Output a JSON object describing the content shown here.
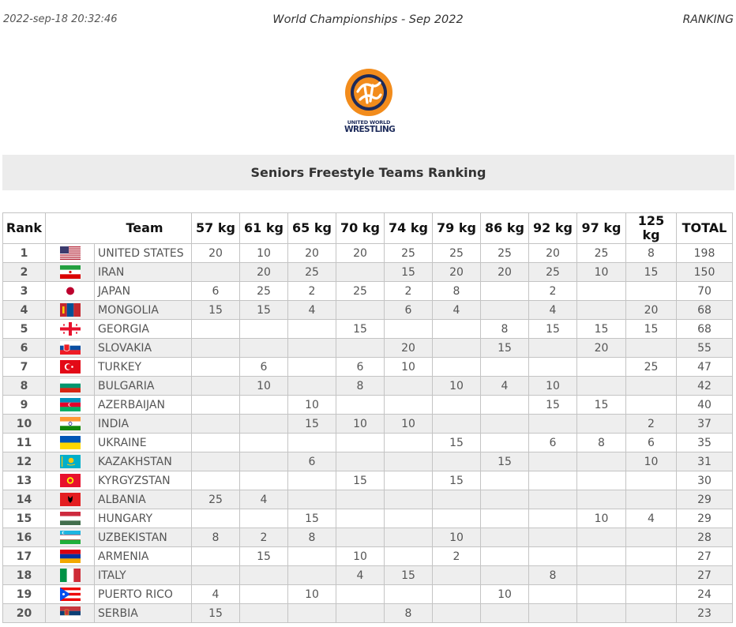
{
  "header": {
    "timestamp": "2022-sep-18 20:32:46",
    "event": "World Championships - Sep 2022",
    "section": "RANKING"
  },
  "logo": {
    "line1": "UNITED WORLD",
    "line2": "WRESTLING"
  },
  "banner": {
    "title": "Seniors Freestyle Teams Ranking"
  },
  "table": {
    "headers": {
      "rank": "Rank",
      "team": "Team",
      "weights": [
        "57 kg",
        "61 kg",
        "65 kg",
        "70 kg",
        "74 kg",
        "79 kg",
        "86 kg",
        "92 kg",
        "97 kg",
        "125 kg"
      ],
      "total": "TOTAL"
    },
    "rows": [
      {
        "rank": "1",
        "flag": "usa-flag-icon",
        "team": "UNITED STATES",
        "scores": [
          "20",
          "10",
          "20",
          "20",
          "25",
          "25",
          "25",
          "20",
          "25",
          "8"
        ],
        "total": "198"
      },
      {
        "rank": "2",
        "flag": "iran-flag-icon",
        "team": "IRAN",
        "scores": [
          "",
          "20",
          "25",
          "",
          "15",
          "20",
          "20",
          "25",
          "10",
          "15"
        ],
        "total": "150"
      },
      {
        "rank": "3",
        "flag": "japan-flag-icon",
        "team": "JAPAN",
        "scores": [
          "6",
          "25",
          "2",
          "25",
          "2",
          "8",
          "",
          "2",
          "",
          ""
        ],
        "total": "70"
      },
      {
        "rank": "4",
        "flag": "mongolia-flag-icon",
        "team": "MONGOLIA",
        "scores": [
          "15",
          "15",
          "4",
          "",
          "6",
          "4",
          "",
          "4",
          "",
          "20"
        ],
        "total": "68"
      },
      {
        "rank": "5",
        "flag": "georgia-flag-icon",
        "team": "GEORGIA",
        "scores": [
          "",
          "",
          "",
          "15",
          "",
          "",
          "8",
          "15",
          "15",
          "15"
        ],
        "total": "68"
      },
      {
        "rank": "6",
        "flag": "slovakia-flag-icon",
        "team": "SLOVAKIA",
        "scores": [
          "",
          "",
          "",
          "",
          "20",
          "",
          "15",
          "",
          "20",
          ""
        ],
        "total": "55"
      },
      {
        "rank": "7",
        "flag": "turkey-flag-icon",
        "team": "TURKEY",
        "scores": [
          "",
          "6",
          "",
          "6",
          "10",
          "",
          "",
          "",
          "",
          "25"
        ],
        "total": "47"
      },
      {
        "rank": "8",
        "flag": "bulgaria-flag-icon",
        "team": "BULGARIA",
        "scores": [
          "",
          "10",
          "",
          "8",
          "",
          "10",
          "4",
          "10",
          "",
          ""
        ],
        "total": "42"
      },
      {
        "rank": "9",
        "flag": "azerbaijan-flag-icon",
        "team": "AZERBAIJAN",
        "scores": [
          "",
          "",
          "10",
          "",
          "",
          "",
          "",
          "15",
          "15",
          ""
        ],
        "total": "40"
      },
      {
        "rank": "10",
        "flag": "india-flag-icon",
        "team": "INDIA",
        "scores": [
          "",
          "",
          "15",
          "10",
          "10",
          "",
          "",
          "",
          "",
          "2"
        ],
        "total": "37"
      },
      {
        "rank": "11",
        "flag": "ukraine-flag-icon",
        "team": "UKRAINE",
        "scores": [
          "",
          "",
          "",
          "",
          "",
          "15",
          "",
          "6",
          "8",
          "6"
        ],
        "total": "35"
      },
      {
        "rank": "12",
        "flag": "kazakhstan-flag-icon",
        "team": "KAZAKHSTAN",
        "scores": [
          "",
          "",
          "6",
          "",
          "",
          "",
          "15",
          "",
          "",
          "10"
        ],
        "total": "31"
      },
      {
        "rank": "13",
        "flag": "kyrgyzstan-flag-icon",
        "team": "KYRGYZSTAN",
        "scores": [
          "",
          "",
          "",
          "15",
          "",
          "15",
          "",
          "",
          "",
          ""
        ],
        "total": "30"
      },
      {
        "rank": "14",
        "flag": "albania-flag-icon",
        "team": "ALBANIA",
        "scores": [
          "25",
          "4",
          "",
          "",
          "",
          "",
          "",
          "",
          "",
          ""
        ],
        "total": "29"
      },
      {
        "rank": "15",
        "flag": "hungary-flag-icon",
        "team": "HUNGARY",
        "scores": [
          "",
          "",
          "15",
          "",
          "",
          "",
          "",
          "",
          "10",
          "4"
        ],
        "total": "29"
      },
      {
        "rank": "16",
        "flag": "uzbekistan-flag-icon",
        "team": "UZBEKISTAN",
        "scores": [
          "8",
          "2",
          "8",
          "",
          "",
          "10",
          "",
          "",
          "",
          ""
        ],
        "total": "28"
      },
      {
        "rank": "17",
        "flag": "armenia-flag-icon",
        "team": "ARMENIA",
        "scores": [
          "",
          "15",
          "",
          "10",
          "",
          "2",
          "",
          "",
          "",
          ""
        ],
        "total": "27"
      },
      {
        "rank": "18",
        "flag": "italy-flag-icon",
        "team": "ITALY",
        "scores": [
          "",
          "",
          "",
          "4",
          "15",
          "",
          "",
          "8",
          "",
          ""
        ],
        "total": "27"
      },
      {
        "rank": "19",
        "flag": "puerto-rico-flag-icon",
        "team": "PUERTO RICO",
        "scores": [
          "4",
          "",
          "10",
          "",
          "",
          "",
          "10",
          "",
          "",
          ""
        ],
        "total": "24"
      },
      {
        "rank": "20",
        "flag": "serbia-flag-icon",
        "team": "SERBIA",
        "scores": [
          "15",
          "",
          "",
          "",
          "8",
          "",
          "",
          "",
          "",
          ""
        ],
        "total": "23"
      }
    ]
  },
  "colors": {
    "brand_orange": "#f28c1c",
    "brand_navy": "#1c2a5a",
    "banner_bg": "#ececec",
    "alt_row": "#eeeeee"
  }
}
